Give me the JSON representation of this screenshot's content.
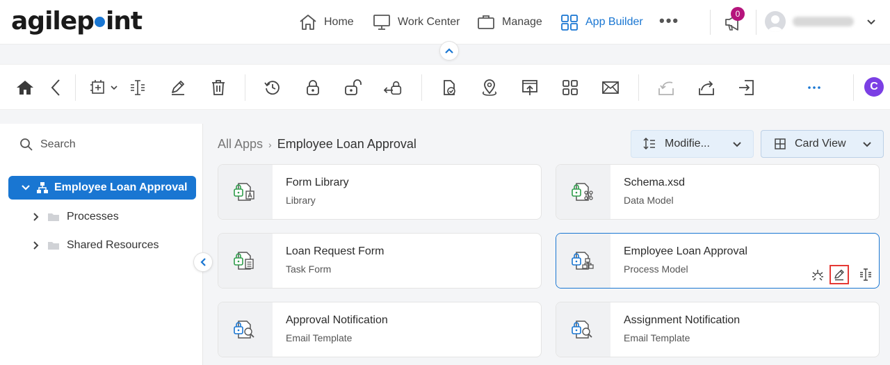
{
  "header": {
    "logo_left": "agilep",
    "logo_right": "int",
    "nav": [
      {
        "label": "Home",
        "icon": "home-icon"
      },
      {
        "label": "Work Center",
        "icon": "monitor-icon"
      },
      {
        "label": "Manage",
        "icon": "briefcase-icon"
      },
      {
        "label": "App Builder",
        "icon": "grid-icon",
        "active": true
      }
    ],
    "more_label": "•••",
    "notification_count": "0"
  },
  "toolbar": {
    "c_label": "C"
  },
  "sidebar": {
    "search_label": "Search",
    "tree": {
      "root_label": "Employee Loan Approval",
      "children": [
        "Processes",
        "Shared Resources"
      ]
    }
  },
  "main": {
    "breadcrumb": {
      "root": "All Apps",
      "separator": "›",
      "current": "Employee Loan Approval"
    },
    "sort_label": "Modifie...",
    "view_label": "Card View",
    "cards": [
      {
        "title": "Form Library",
        "subtitle": "Library",
        "icon": "form-library-icon"
      },
      {
        "title": "Schema.xsd",
        "subtitle": "Data Model",
        "icon": "data-model-icon"
      },
      {
        "title": "Loan Request Form",
        "subtitle": "Task Form",
        "icon": "task-form-icon"
      },
      {
        "title": "Employee Loan Approval",
        "subtitle": "Process Model",
        "icon": "process-model-icon",
        "selected": true
      },
      {
        "title": "Approval Notification",
        "subtitle": "Email Template",
        "icon": "email-template-icon"
      },
      {
        "title": "Assignment Notification",
        "subtitle": "Email Template",
        "icon": "email-template-icon"
      }
    ]
  },
  "colors": {
    "accent": "#1976d2",
    "badge": "#b5147c",
    "lock_green": "#2e9d4a",
    "highlight_red": "#e53935",
    "c_purple": "#7b3fe4"
  }
}
